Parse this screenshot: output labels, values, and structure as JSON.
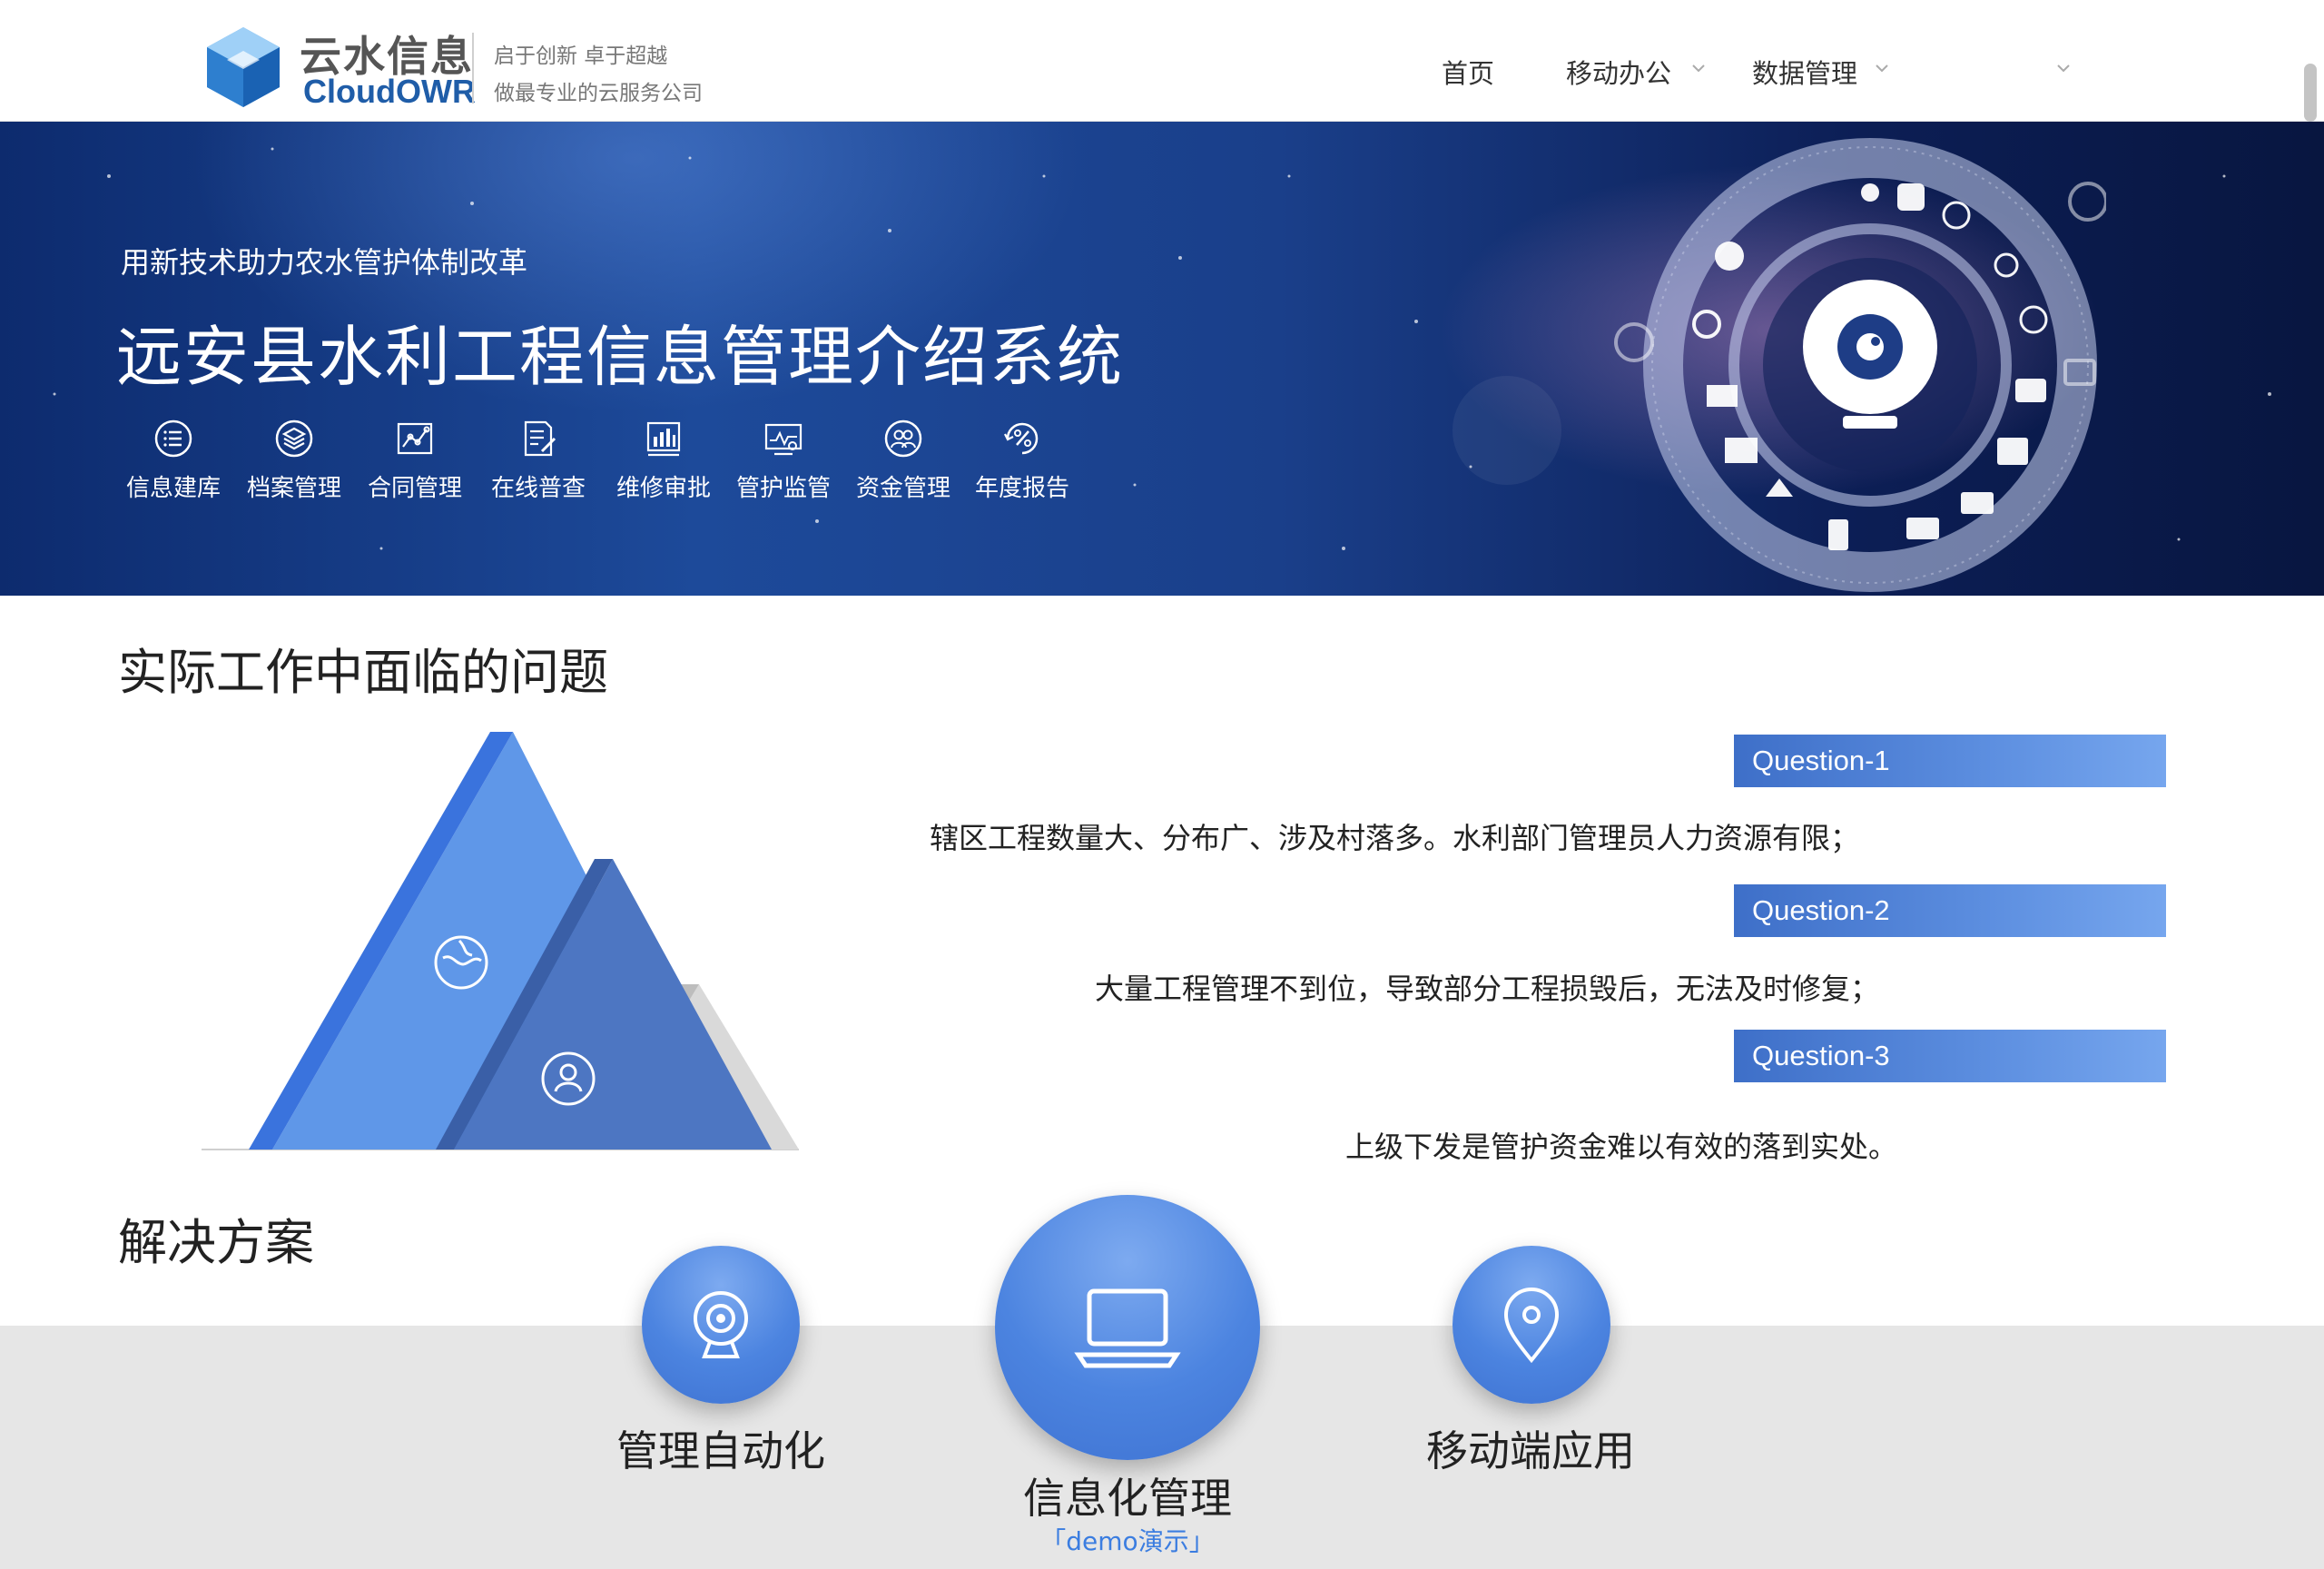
{
  "header": {
    "brand_cn": "云水信息",
    "brand_en": "CloudOWR",
    "slogan_line1": "启于创新 卓于超越",
    "slogan_line2": "做最专业的云服务公司",
    "nav": [
      {
        "label": "首页",
        "has_dropdown": false
      },
      {
        "label": "移动办公",
        "has_dropdown": true
      },
      {
        "label": "数据管理",
        "has_dropdown": true
      },
      {
        "label": "",
        "has_dropdown": true
      }
    ]
  },
  "banner": {
    "subtitle": "用新技术助力农水管护体制改革",
    "title": "远安县水利工程信息管理介绍系统",
    "features": [
      {
        "label": "信息建库",
        "icon": "list-icon"
      },
      {
        "label": "档案管理",
        "icon": "layers-icon"
      },
      {
        "label": "合同管理",
        "icon": "chart-nodes-icon"
      },
      {
        "label": "在线普查",
        "icon": "edit-document-icon"
      },
      {
        "label": "维修审批",
        "icon": "bar-chart-icon"
      },
      {
        "label": "管护监管",
        "icon": "monitor-eye-icon"
      },
      {
        "label": "资金管理",
        "icon": "users-icon"
      },
      {
        "label": "年度报告",
        "icon": "percent-refresh-icon"
      }
    ]
  },
  "problems": {
    "title": "实际工作中面临的问题",
    "questions": [
      {
        "badge": "Question-1",
        "text": "辖区工程数量大、分布广、涉及村落多。水利部门管理员人力资源有限；"
      },
      {
        "badge": "Question-2",
        "text": "大量工程管理不到位，导致部分工程损毁后，无法及时修复；"
      },
      {
        "badge": "Question-3",
        "text": "上级下发是管护资金难以有效的落到实处。"
      }
    ]
  },
  "solutions": {
    "title": "解决方案",
    "items": [
      {
        "label": "管理自动化",
        "icon": "webcam-icon"
      },
      {
        "label": "信息化管理",
        "icon": "laptop-icon",
        "demo": "「demo演示」"
      },
      {
        "label": "移动端应用",
        "icon": "location-pin-icon"
      }
    ]
  },
  "colors": {
    "accent_blue": "#4c84e0",
    "banner_dark": "#0d2b6e",
    "grey_band": "#e6e6e6"
  }
}
